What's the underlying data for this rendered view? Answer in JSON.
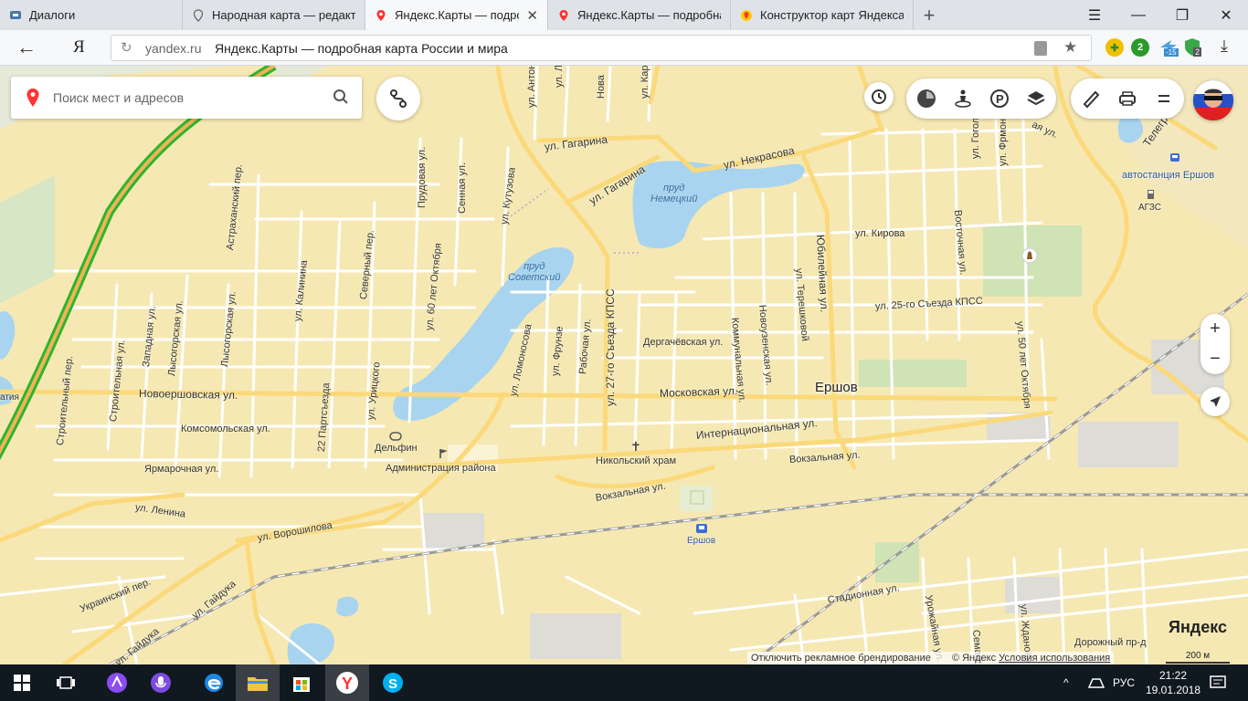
{
  "browser": {
    "tabs": [
      {
        "label": "Диалоги",
        "icon": "chat-icon",
        "active": false
      },
      {
        "label": "Народная карта — редакто",
        "icon": "pin-icon",
        "active": false
      },
      {
        "label": "Яндекс.Карты — подроб",
        "icon": "red-pin-icon",
        "active": true
      },
      {
        "label": "Яндекс.Карты — подробна",
        "icon": "red-pin-icon",
        "active": false
      },
      {
        "label": "Конструктор карт Яндекса",
        "icon": "yellow-pin-icon",
        "active": false
      }
    ],
    "ya_logo": "Я",
    "url_domain": "yandex.ru",
    "url_title": "Яндекс.Карты — подробная карта России и мира",
    "ext_badges": [
      "2",
      "-15",
      "2"
    ]
  },
  "search": {
    "placeholder": "Поиск мест и адресов"
  },
  "map": {
    "city": "Ершов",
    "streets": [
      "ул. Антоно",
      "ул. Ла",
      "Нова",
      "ул. Карл",
      "ул. Гагарина",
      "ул. Гагарина",
      "ул. Некрасова",
      "ул. Гоголя",
      "ул. Фрмонова",
      "Телеграфна",
      "ая ул.",
      "Прудовая ул.",
      "Сенная ул.",
      "ул. Кутузова",
      "Астраханский пер.",
      "ул. Калинина",
      "Северный пер.",
      "ул. 60 лет Октября",
      "ул. 27-го Съезда КПСС",
      "Коммунальная ул.",
      "Юбилейная ул.",
      "ул. Терешковой",
      "ул. Кирова",
      "Восточная ул.",
      "Новоузенская ул.",
      "ул. 25-го Съезда КПСС",
      "ул. 50 лет Октября",
      "Западная ул.",
      "Лысогорская ул.",
      "Лысогорская ул.",
      "Строительная ул.",
      "Строительный пер.",
      "ул. Ломоносова",
      "ул. Фрунзе",
      "Рабочая ул.",
      "Дергачёвская ул.",
      "Новоершовская ул.",
      "Московская ул.",
      "22 Партсъезда",
      "ул. Урицкого",
      "Комсомольская ул.",
      "Интернациональная ул.",
      "Ярмарочная ул.",
      "Вокзальная ул.",
      "Вокзальная ул.",
      "ул. Ленина",
      "ул. Ворошилова",
      "Украинский пер.",
      "ул. Гайдука",
      "ул. Гайдука",
      "Стадионная ул.",
      "Урожайная ул.",
      "Семаф",
      "ул. Жданова",
      "Дорожный пр-д"
    ],
    "water": [
      "пруд Немецкий",
      "пруд Советский"
    ],
    "pois": [
      "автостанция Ершов",
      "АГЗС",
      "Дельфин",
      "Администрация района",
      "Никольский храм",
      "Ершов"
    ],
    "cut_label": "атия",
    "footer_disable": "Отключить рекламное брендирование",
    "footer_copy": "© Яндекс",
    "footer_terms": "Условия использования",
    "logo": "Яндекс",
    "scale": "200 м",
    "zoom_in": "+",
    "zoom_out": "−"
  },
  "taskbar": {
    "lang": "РУС",
    "time": "21:22",
    "date": "19.01.2018"
  },
  "colors": {
    "land": "#f6e8b3",
    "road": "#ffffff",
    "main_road": "#fbd97a",
    "water": "#a8d4ef",
    "park": "#cfe3b5",
    "highway_green": "#2db52d",
    "accent_red": "#ff3333"
  }
}
